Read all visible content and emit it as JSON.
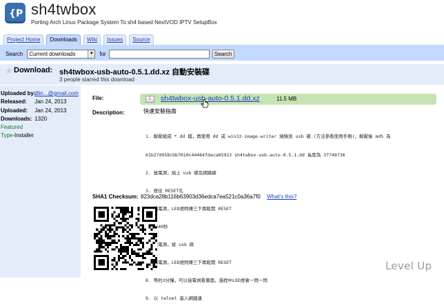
{
  "header": {
    "title": "sh4twbox",
    "summary": "Porting Arch Linux Package System To sh4 based NextVOD IPTV SetupBox"
  },
  "tabs": [
    {
      "label": "Project Home",
      "active": false
    },
    {
      "label": "Downloads",
      "active": true
    },
    {
      "label": "Wiki",
      "active": false
    },
    {
      "label": "Issues",
      "active": false
    },
    {
      "label": "Source",
      "active": false
    }
  ],
  "search": {
    "search_label": "Search",
    "scope_selected": "Current downloads",
    "for_label": "for",
    "query_value": "",
    "button_label": "Search"
  },
  "download": {
    "label": "Download:",
    "filename": "sh4twbox-usb-auto-0.5.1.dd.xz 自動安裝碟",
    "starred_text": "3 people starred this download"
  },
  "meta": {
    "uploaded_by_label": "Uploaded by:",
    "uploaded_by_value": "dlin...@gmail.com",
    "released_label": "Released:",
    "released_value": "Jan 24, 2013",
    "uploaded_label": "Uploaded:",
    "uploaded_value": "Jan 24, 2013",
    "downloads_label": "Downloads:",
    "downloads_value": "1320",
    "label_featured": "Featured",
    "label_type_prefix": "Type",
    "label_type_value": "-Installer"
  },
  "file": {
    "label": "File:",
    "link": "sh4twbox-usb-auto-0.5.1.dd.xz",
    "size": "11.5 MB"
  },
  "description": {
    "label": "Description:",
    "title": "快速安裝指南",
    "steps": [
      "1. 解壓縮成 *.dd 檔，再使用 dd 或 win32-image-writer 燒錄到 usb 碟.(方法參看使用手冊)，解壓後 md5 為",
      "61b27d958cbb7010c44464fdaca65922 sh4twbox-usb-auto-0.5.1.dd 長度為 37748736",
      "2. 拔電源，插上 usb 碟及網路線",
      "3. 按住 RESET孔",
      "4. 插電源，LED燈閃爍三下再鬆開 RESET",
      "5. 等40秒",
      "6. 拔電源，拔 usb 碟",
      "7. 插電源，LED燈閃爍三下再鬆開 RESET",
      "8. 等約3分鐘，可以接電視看畫面，過程中LED燈會一閃一閃",
      "9. 以 telnet 進入網牆連"
    ]
  },
  "sha1": {
    "label": "SHA1 Checksum:",
    "value": "823dca28b116b63903d36edca7ea521c0a36a7f0",
    "help_link": "What's this?"
  },
  "watermark": "Level Up",
  "colors": {
    "tab_bar": "#c3d9ff",
    "side_panel": "#e5ecf9",
    "file_highlight": "#c5e3b3",
    "link": "#1a3fbf",
    "featured_label": "#0a7d23"
  }
}
